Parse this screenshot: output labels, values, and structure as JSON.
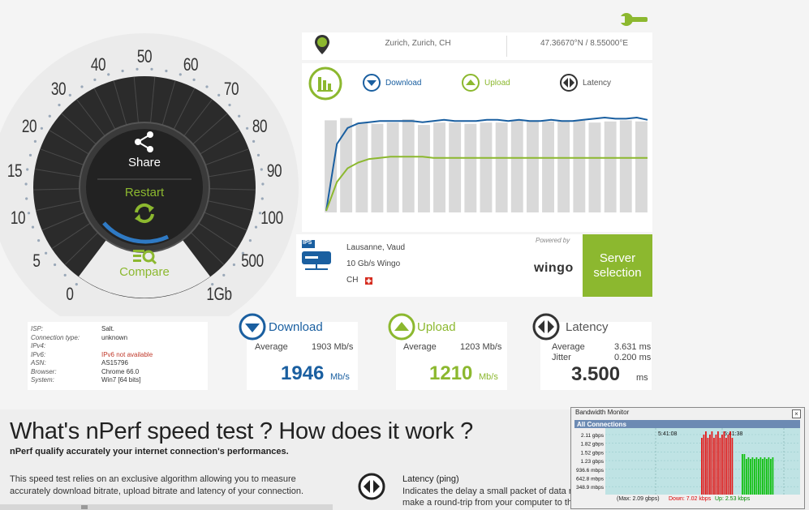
{
  "location": {
    "city": "Zurich, Zurich, CH",
    "coords": "47.36670°N / 8.55000°E"
  },
  "legend": {
    "download": "Download",
    "upload": "Upload",
    "latency": "Latency"
  },
  "gauge": {
    "share": "Share",
    "restart": "Restart",
    "compare": "Compare",
    "ticks": [
      "0",
      "5",
      "10",
      "15",
      "20",
      "30",
      "40",
      "50",
      "60",
      "70",
      "80",
      "90",
      "100",
      "500",
      "1Gb"
    ]
  },
  "chart_data": {
    "type": "line",
    "series": [
      {
        "name": "Download",
        "values": [
          0.0,
          0.58,
          0.72,
          0.76,
          0.77,
          0.78,
          0.78,
          0.78,
          0.78,
          0.77,
          0.78,
          0.79,
          0.78,
          0.78,
          0.78,
          0.79,
          0.79,
          0.78,
          0.79,
          0.78,
          0.78,
          0.79,
          0.78,
          0.78,
          0.79,
          0.8,
          0.81,
          0.8,
          0.8,
          0.81,
          0.79
        ]
      },
      {
        "name": "Upload",
        "values": [
          0.0,
          0.25,
          0.37,
          0.42,
          0.45,
          0.46,
          0.47,
          0.47,
          0.47,
          0.47,
          0.46,
          0.46,
          0.46,
          0.46,
          0.46,
          0.46,
          0.46,
          0.46,
          0.46,
          0.46,
          0.46,
          0.46,
          0.46,
          0.46,
          0.46,
          0.46,
          0.46,
          0.46,
          0.46,
          0.46,
          0.46
        ]
      }
    ],
    "bars": [
      0.8,
      0.82,
      0.78,
      0.77,
      0.78,
      0.81,
      0.76,
      0.78,
      0.78,
      0.77,
      0.78,
      0.78,
      0.8,
      0.8,
      0.79,
      0.8,
      0.8,
      0.78,
      0.79,
      0.8,
      0.79
    ]
  },
  "server": {
    "badge": "IPS",
    "city": "Lausanne, Vaud",
    "provider": "10 Gb/s Wingo",
    "country": "CH",
    "powered_by": "Powered by",
    "brand": "wingo",
    "button_line1": "Server",
    "button_line2": "selection"
  },
  "info": [
    {
      "k": "ISP:",
      "v": "Salt."
    },
    {
      "k": "Connection type:",
      "v": "unknown"
    },
    {
      "k": "IPv4:",
      "v": ""
    },
    {
      "k": "IPv6:",
      "v": "IPv6 not available"
    },
    {
      "k": "ASN:",
      "v": "AS15796"
    },
    {
      "k": "Browser:",
      "v": "Chrome 66.0"
    },
    {
      "k": "System:",
      "v": "Win7 [64 bits]"
    }
  ],
  "download": {
    "title": "Download",
    "avg_label": "Average",
    "avg": "1903 Mb/s",
    "value": "1946",
    "unit": "Mb/s"
  },
  "upload": {
    "title": "Upload",
    "avg_label": "Average",
    "avg": "1203 Mb/s",
    "value": "1210",
    "unit": "Mb/s"
  },
  "latency": {
    "title": "Latency",
    "avg_label": "Average",
    "avg": "3.631 ms",
    "jitter_label": "Jitter",
    "jitter": "0.200 ms",
    "value": "3.500",
    "unit": "ms"
  },
  "article": {
    "heading": "What's nPerf speed test ? How does it work ?",
    "subheading": "nPerf qualify accurately your internet connection's performances.",
    "para_line1": "This speed test relies on an exclusive algorithm allowing you to measure",
    "para_line2": "accurately download bitrate, upload bitrate and latency of your connection.",
    "latency_title": "Latency (ping)",
    "latency_line1": "Indicates the delay a small packet of data requ",
    "latency_line2": "make a round-trip from your computer to the n"
  },
  "bandwidth": {
    "title": "Bandwidth Monitor",
    "tab": "All Connections",
    "yticks": [
      "2.11 gbps",
      "1.82 gbps",
      "1.52 gbps",
      "1.23 gbps",
      "936.6 mbps",
      "642.8 mbps",
      "348.9 mbps"
    ],
    "time1": "5:41:08",
    "time2": "5:41:38",
    "max": "(Max: 2.09 gbps)",
    "down": "Down: 7.02 kbps",
    "up": "Up: 2.53 kbps"
  },
  "colors": {
    "download": "#1a5fa0",
    "upload": "#8cb82f",
    "dark": "#333333",
    "server_button": "#8cb82f"
  }
}
